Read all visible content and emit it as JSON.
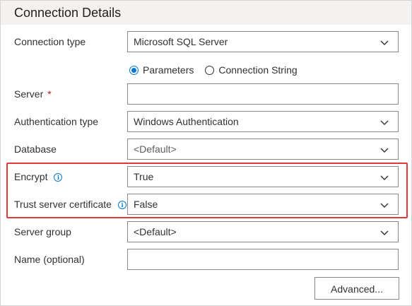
{
  "header": {
    "title": "Connection Details"
  },
  "fields": {
    "connection_type": {
      "label": "Connection type",
      "value": "Microsoft SQL Server"
    },
    "server": {
      "label": "Server",
      "required_mark": "*",
      "value": ""
    },
    "auth_type": {
      "label": "Authentication type",
      "value": "Windows Authentication"
    },
    "database": {
      "label": "Database",
      "value": "<Default>"
    },
    "encrypt": {
      "label": "Encrypt",
      "info": "i",
      "value": "True"
    },
    "trust_cert": {
      "label": "Trust server certificate",
      "info": "i",
      "value": "False"
    },
    "server_group": {
      "label": "Server group",
      "value": "<Default>"
    },
    "name": {
      "label": "Name (optional)",
      "value": ""
    }
  },
  "connection_mode": {
    "options": [
      "Parameters",
      "Connection String"
    ],
    "selected": "Parameters"
  },
  "buttons": {
    "advanced": "Advanced..."
  },
  "colors": {
    "accent": "#0078d4",
    "highlight_border": "#e03a3a",
    "required": "#c50f1f",
    "header_bg": "#f3f2f1"
  },
  "icons": {
    "dropdown": "chevron-down-icon",
    "info": "info-icon"
  }
}
